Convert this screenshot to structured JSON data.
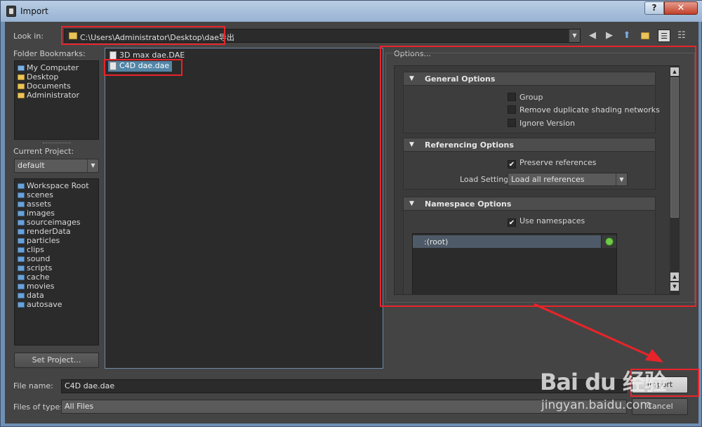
{
  "window": {
    "title": "Import",
    "help_glyph": "?",
    "close_glyph": "✕"
  },
  "look_in": {
    "label": "Look in:",
    "path": "C:\\Users\\Administrator\\Desktop\\dae导出"
  },
  "bookmarks": {
    "label": "Folder Bookmarks:",
    "items": [
      "My Computer",
      "Desktop",
      "Documents",
      "Administrator"
    ]
  },
  "project": {
    "label": "Current Project:",
    "value": "default",
    "folders": [
      "Workspace Root",
      "scenes",
      "assets",
      "images",
      "sourceimages",
      "renderData",
      "particles",
      "clips",
      "sound",
      "scripts",
      "cache",
      "movies",
      "data",
      "autosave"
    ],
    "set_button": "Set Project..."
  },
  "files": {
    "items": [
      "3D max dae.DAE",
      "C4D dae.dae"
    ],
    "selected_index": 1
  },
  "options": {
    "label": "Options...",
    "general": {
      "title": "General Options",
      "group": "Group",
      "remove_dup": "Remove duplicate shading networks",
      "ignore_version": "Ignore Version"
    },
    "referencing": {
      "title": "Referencing Options",
      "preserve": "Preserve references",
      "load_settings_label": "Load Settings",
      "load_settings_value": "Load all references"
    },
    "namespace": {
      "title": "Namespace Options",
      "use_ns": "Use namespaces",
      "root": ":(root)"
    }
  },
  "bottom": {
    "file_name_label": "File name:",
    "file_name_value": "C4D dae.dae",
    "file_type_label": "Files of type:",
    "file_type_value": "All Files",
    "import_button": "Import",
    "cancel_button": "Cancel"
  },
  "watermark": {
    "logo": "Bai du 经验",
    "url": "jingyan.baidu.com"
  },
  "colors": {
    "highlight_red": "#e8242a",
    "selection_blue": "#5285a6",
    "panel_bg": "#444444"
  }
}
